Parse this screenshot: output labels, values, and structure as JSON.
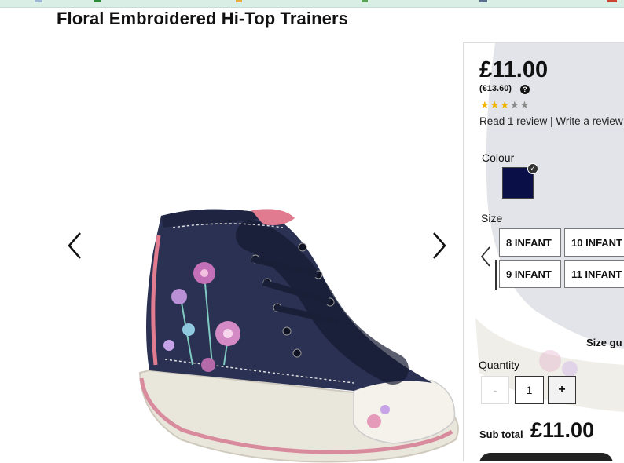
{
  "product": {
    "title": "Floral Embroidered Hi-Top Trainers",
    "price": "£11.00",
    "alt_price": "(€13.60)",
    "rating": {
      "value": 3,
      "max": 5
    },
    "read_reviews": "Read 1 review",
    "review_separator": "|",
    "write_review": "Write a review"
  },
  "colour": {
    "label": "Colour",
    "swatches": [
      {
        "color": "#0a0f47",
        "selected": true
      }
    ]
  },
  "size": {
    "label": "Size",
    "options": [
      "8 INFANT",
      "10 INFANT",
      "9 INFANT",
      "11 INFANT"
    ],
    "guide": "Size gu"
  },
  "quantity": {
    "label": "Quantity",
    "minus": "-",
    "value": "1",
    "plus": "+"
  },
  "subtotal": {
    "label": "Sub total",
    "value": "£11.00"
  },
  "gallery": {
    "prev_icon": "chevron-left-icon",
    "next_icon": "chevron-right-icon"
  }
}
